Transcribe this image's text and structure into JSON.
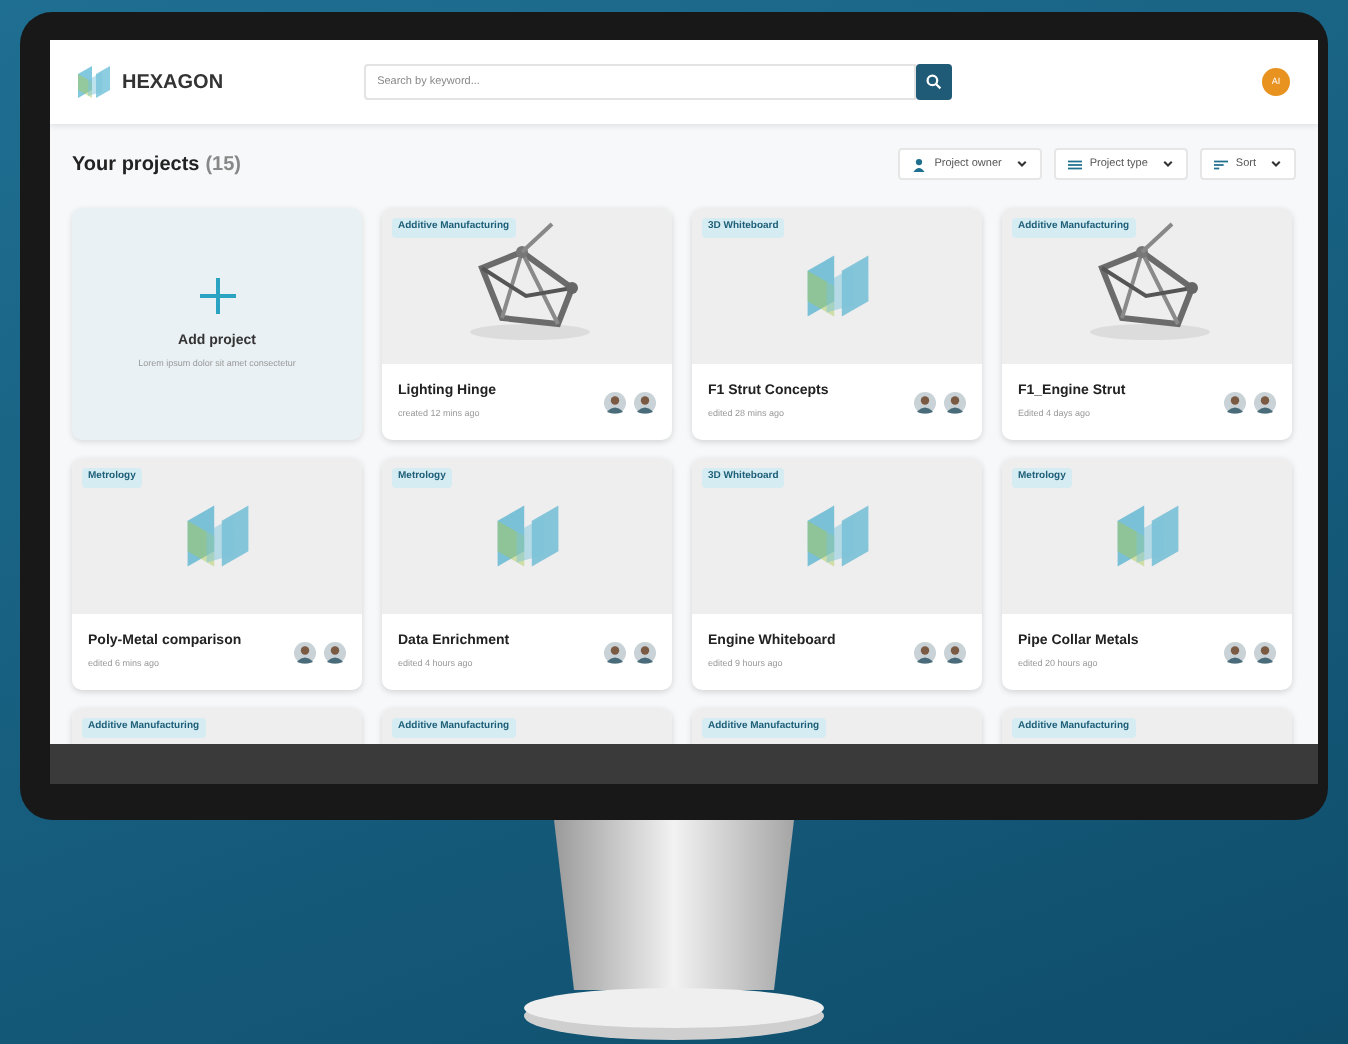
{
  "header": {
    "brand": "HEXAGON",
    "search": {
      "placeholder": "Search by keyword..."
    },
    "user_initials": "AI"
  },
  "title": {
    "text": "Your projects",
    "count": "(15)"
  },
  "filters": [
    {
      "kind": "owner",
      "label": "Project owner"
    },
    {
      "kind": "type",
      "label": "Project type"
    },
    {
      "kind": "sort",
      "label": "Sort"
    }
  ],
  "add_card": {
    "title": "Add project",
    "description": "Lorem ipsum dolor sit amet consectetur"
  },
  "projects": [
    {
      "tag": "Additive Manufacturing",
      "kind": "picture",
      "name": "Lighting Hinge",
      "meta": "created 12 mins ago"
    },
    {
      "tag": "3D Whiteboard",
      "kind": "placeholder",
      "name": "F1 Strut Concepts",
      "meta": "edited 28 mins ago"
    },
    {
      "tag": "Additive Manufacturing",
      "kind": "picture",
      "name": "F1_Engine Strut",
      "meta": "Edited 4 days ago"
    },
    {
      "tag": "Metrology",
      "kind": "placeholder",
      "name": "Poly-Metal comparison",
      "meta": "edited 6 mins ago"
    },
    {
      "tag": "Metrology",
      "kind": "placeholder",
      "name": "Data Enrichment",
      "meta": "edited 4 hours ago"
    },
    {
      "tag": "3D Whiteboard",
      "kind": "placeholder",
      "name": "Engine Whiteboard",
      "meta": "edited 9 hours ago"
    },
    {
      "tag": "Metrology",
      "kind": "placeholder",
      "name": "Pipe Collar Metals",
      "meta": "edited 20 hours ago"
    },
    {
      "tag": "Additive Manufacturing"
    },
    {
      "tag": "Additive Manufacturing"
    },
    {
      "tag": "Additive Manufacturing"
    },
    {
      "tag": "Additive Manufacturing"
    }
  ]
}
